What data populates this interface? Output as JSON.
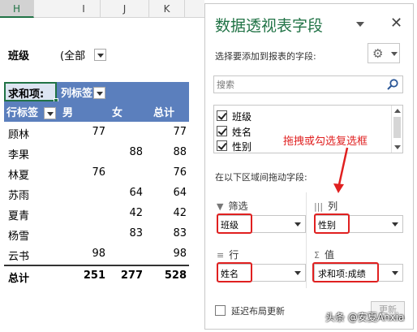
{
  "sheet": {
    "columns": [
      "H",
      "I",
      "J",
      "K"
    ],
    "filter": {
      "label": "班级",
      "value": "(全部"
    },
    "pivot": {
      "value_header": "求和项:",
      "col_header": "列标签",
      "row_header": "行标签",
      "col_male": "男",
      "col_female": "女",
      "col_total": "总计",
      "rows": [
        {
          "name": "顾林",
          "male": "77",
          "female": "",
          "total": "77"
        },
        {
          "name": "李果",
          "male": "",
          "female": "88",
          "total": "88"
        },
        {
          "name": "林夏",
          "male": "76",
          "female": "",
          "total": "76"
        },
        {
          "name": "苏雨",
          "male": "",
          "female": "64",
          "total": "64"
        },
        {
          "name": "夏青",
          "male": "",
          "female": "42",
          "total": "42"
        },
        {
          "name": "杨雪",
          "male": "",
          "female": "83",
          "total": "83"
        },
        {
          "name": "云书",
          "male": "98",
          "female": "",
          "total": "98"
        }
      ],
      "total": {
        "name": "总计",
        "male": "251",
        "female": "277",
        "total": "528"
      }
    }
  },
  "panel": {
    "title": "数据透视表字段",
    "close": "✕",
    "choose_label": "选择要添加到报表的字段:",
    "search_placeholder": "搜索",
    "fields": [
      {
        "name": "班级",
        "checked": true
      },
      {
        "name": "姓名",
        "checked": true
      },
      {
        "name": "性别",
        "checked": true
      }
    ],
    "annotation": "拖拽或勾选复选框",
    "drag_label": "在以下区域间拖动字段:",
    "areas": {
      "filters": {
        "icon": "▼",
        "title": "筛选",
        "item": "班级"
      },
      "columns": {
        "icon": "|||",
        "title": "列",
        "item": "性别"
      },
      "rows": {
        "icon": "≡",
        "title": "行",
        "item": "姓名"
      },
      "values": {
        "icon": "Σ",
        "title": "值",
        "item": "求和项:成绩"
      }
    },
    "defer_label": "延迟布局更新",
    "update_label": "更新",
    "watermark": "头条 @安夏Anxia"
  },
  "colors": {
    "accent": "#217346",
    "pivot_header": "#5b7fbd",
    "annotation": "#e02020"
  }
}
